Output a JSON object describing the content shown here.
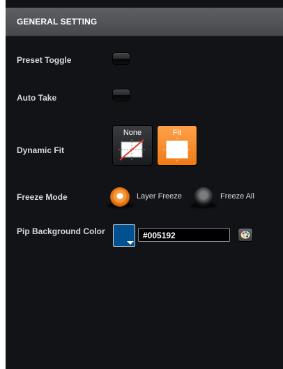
{
  "header": {
    "title": "GENERAL SETTING"
  },
  "settings": {
    "preset_toggle": {
      "label": "Preset Toggle",
      "enabled": false
    },
    "auto_take": {
      "label": "Auto Take",
      "enabled": false
    },
    "dynamic_fit": {
      "label": "Dynamic Fit",
      "options": [
        "None",
        "Fit"
      ],
      "selected": "Fit"
    },
    "freeze_mode": {
      "label": "Freeze Mode",
      "options": [
        "Layer Freeze",
        "Freeze All"
      ],
      "selected": "Layer Freeze"
    },
    "pip_background_color": {
      "label": "Pip Background Color",
      "value": "#005192"
    }
  },
  "colors": {
    "accent": "#f2801c",
    "panel_bg": "#121316",
    "swatch": "#005192"
  },
  "icons": {
    "picker": "palette-icon"
  }
}
